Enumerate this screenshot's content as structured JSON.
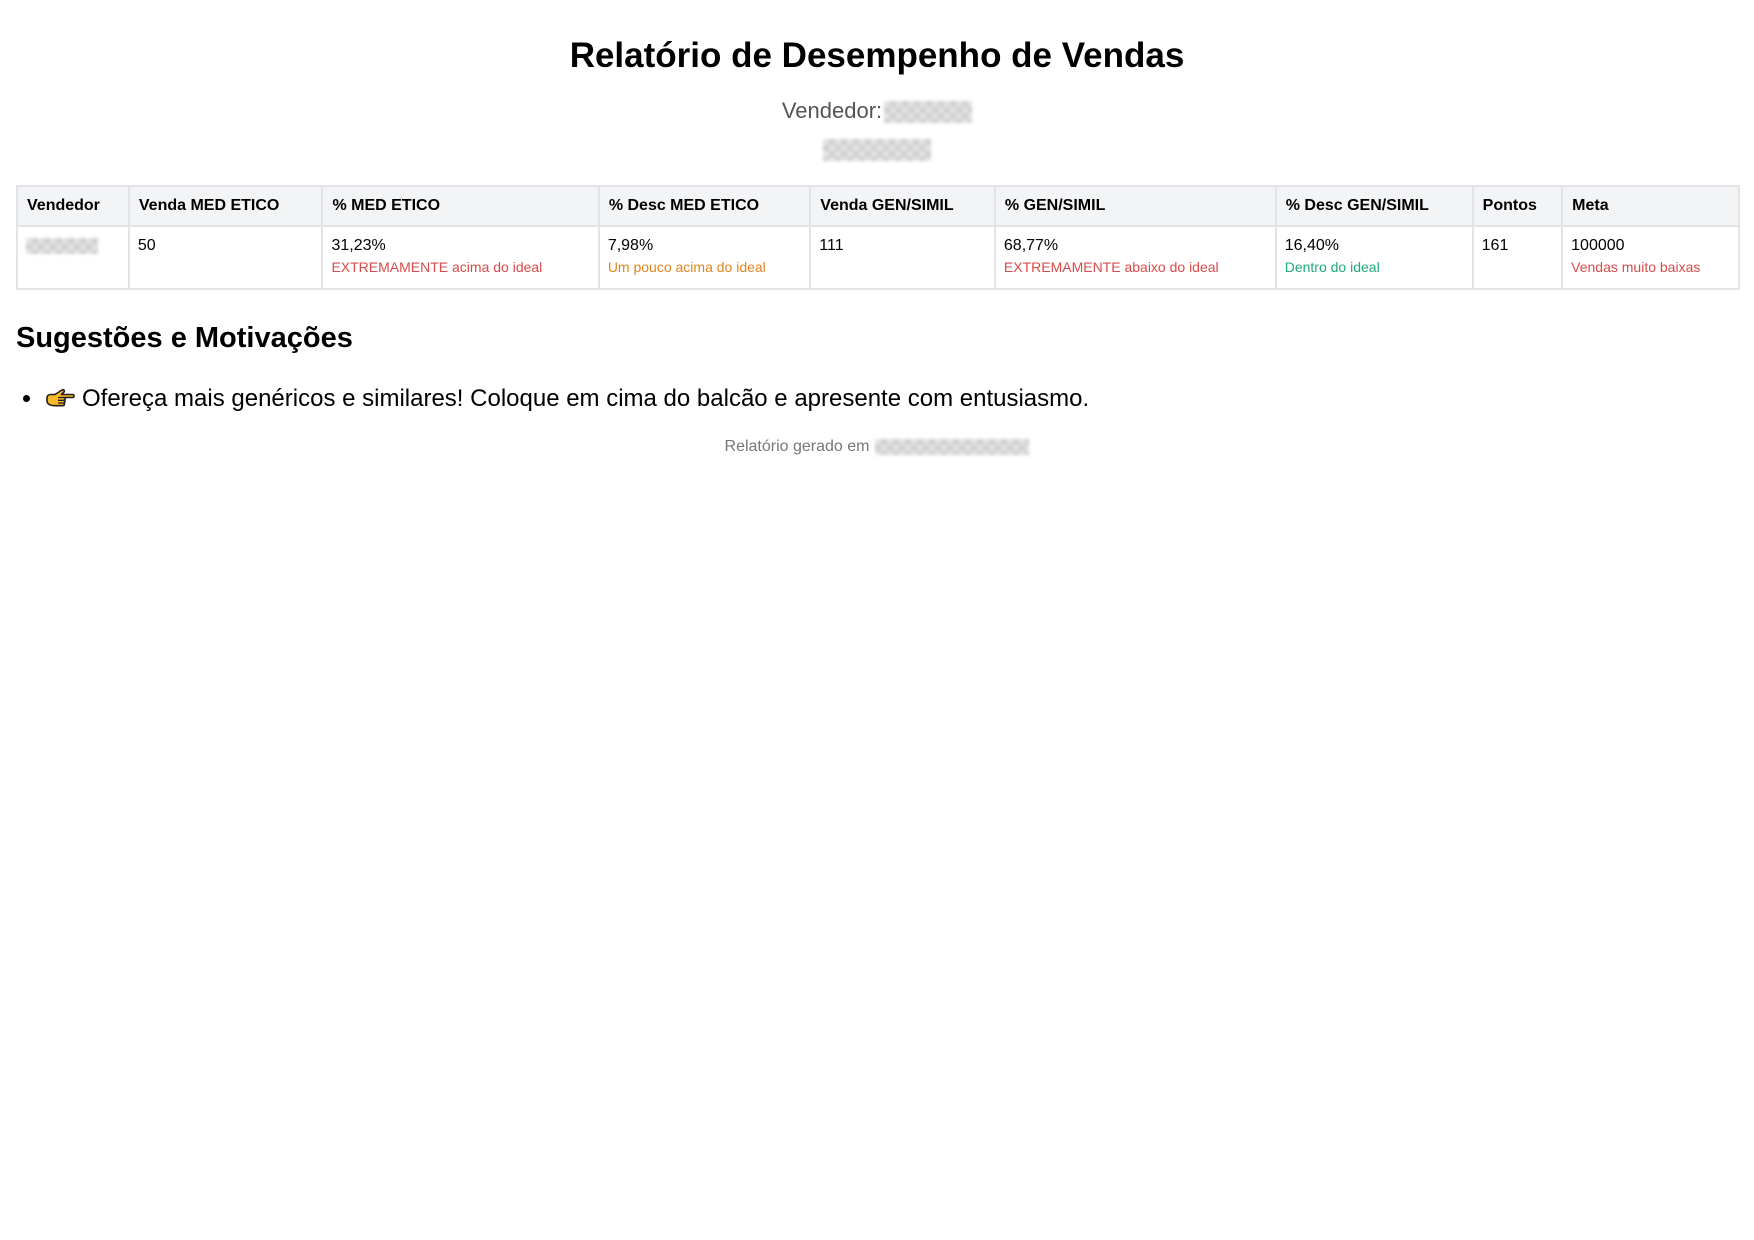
{
  "report": {
    "title": "Relatório de Desempenho de Vendas",
    "vendor_label": "Vendedor:"
  },
  "table": {
    "headers": [
      "Vendedor",
      "Venda MED ETICO",
      "% MED ETICO",
      "% Desc MED ETICO",
      "Venda GEN/SIMIL",
      "% GEN/SIMIL",
      "% Desc GEN/SIMIL",
      "Pontos",
      "Meta"
    ],
    "row": {
      "venda_med_etico": "50",
      "pct_med_etico": "31,23%",
      "pct_med_etico_status": "EXTREMAMENTE acima do ideal",
      "pct_desc_med_etico": "7,98%",
      "pct_desc_med_etico_status": "Um pouco acima do ideal",
      "venda_gen_simil": "111",
      "pct_gen_simil": "68,77%",
      "pct_gen_simil_status": "EXTREMAMENTE abaixo do ideal",
      "pct_desc_gen_simil": "16,40%",
      "pct_desc_gen_simil_status": "Dentro do ideal",
      "pontos": "161",
      "meta": "100000",
      "meta_status": "Vendas muito baixas"
    }
  },
  "suggestions": {
    "heading": "Sugestões e Motivações",
    "items": [
      {
        "icon": "pointing-hand-icon",
        "text": "Ofereça mais genéricos e similares! Coloque em cima do balcão e apresente com entusiasmo."
      }
    ]
  },
  "footer": {
    "label": "Relatório gerado em"
  },
  "colors": {
    "status_bad": "#d94b4b",
    "status_warning": "#e0851f",
    "status_good": "#21a87d",
    "header_bg": "#f3f4f6",
    "border": "#e2e4e8"
  }
}
